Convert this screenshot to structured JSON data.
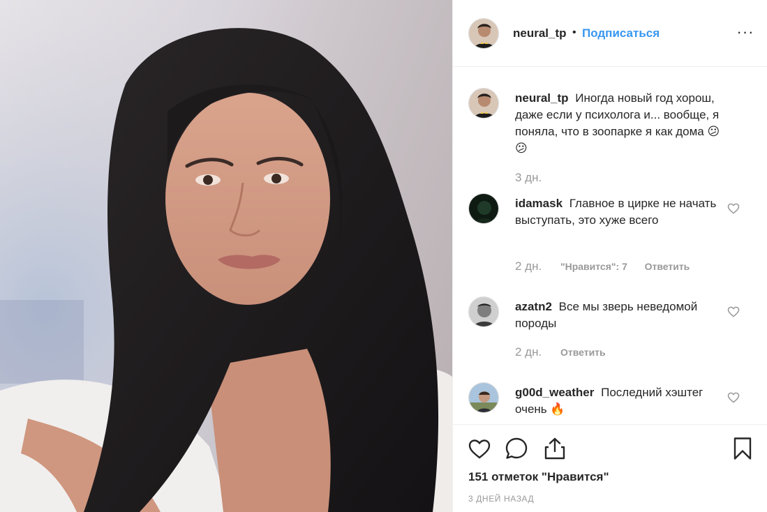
{
  "post": {
    "author": "neural_tp",
    "dot": "•",
    "follow_label": "Подписаться",
    "more_label": "···",
    "likes_text": "151 отметок \"Нравится\"",
    "posted_ago": "3 ДНЕЙ НАЗАД"
  },
  "caption": {
    "user": "neural_tp",
    "text": "Иногда новый год хорош, даже если у психолога и... вообще, я поняла, что в зоопарке я как дома 😕😕",
    "time": "3 дн."
  },
  "comments": [
    {
      "user": "idamask",
      "text": "Главное в цирке не начать выступать, это хуже всего",
      "time": "2 дн.",
      "likes": "\"Нравится\": 7",
      "reply": "Ответить"
    },
    {
      "user": "azatn2",
      "text": "Все мы зверь неведомой породы",
      "time": "2 дн.",
      "reply": "Ответить"
    },
    {
      "user": "g00d_weather",
      "text": "Последний хэштег очень 🔥"
    }
  ],
  "colors": {
    "accent": "#3897f0",
    "text": "#262626",
    "muted": "#999999",
    "border": "#efefef"
  },
  "icons": [
    "more-options-icon",
    "heart-icon",
    "comment-icon",
    "share-icon",
    "bookmark-icon"
  ]
}
